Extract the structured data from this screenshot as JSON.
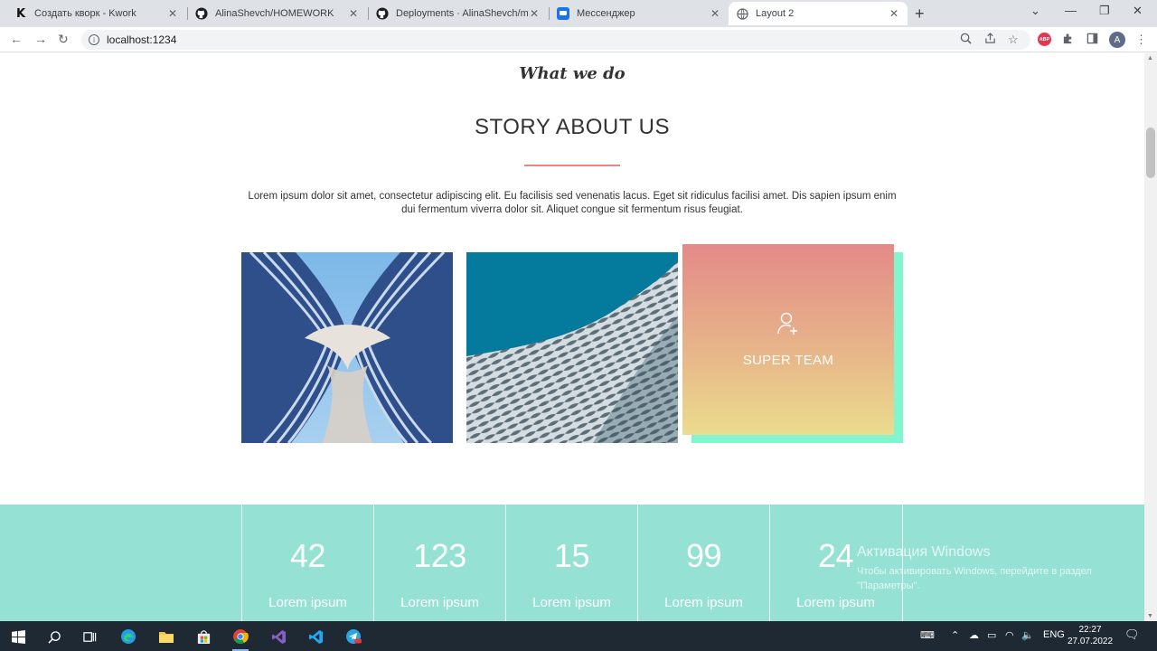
{
  "browser": {
    "tabs": [
      {
        "title": "Создать кворк - Kwork",
        "icon": "kwork-icon",
        "active": false
      },
      {
        "title": "AlinaShevch/HOMEWORK",
        "icon": "github-icon",
        "active": false
      },
      {
        "title": "Deployments · AlinaShevch/mod",
        "icon": "github-icon",
        "active": false
      },
      {
        "title": "Мессенджер",
        "icon": "messenger-icon",
        "active": false
      },
      {
        "title": "Layout 2",
        "icon": "globe-icon",
        "active": true
      }
    ],
    "url": "localhost:1234"
  },
  "page": {
    "subtitle": "What we do",
    "heading": "STORY ABOUT US",
    "lorem": "Lorem ipsum dolor sit amet, consectetur adipiscing elit. Eu facilisis sed venenatis lacus. Eget sit ridiculus facilisi amet. Dis sapien ipsum enim dui fermentum viverra dolor sit. Aliquet congue sit fermentum risus feugiat.",
    "team_label": "SUPER TEAM",
    "accent_color": "#f38181",
    "stats_bg": "#95e1d3",
    "stats": [
      {
        "value": "42",
        "label": "Lorem ipsum"
      },
      {
        "value": "123",
        "label": "Lorem ipsum"
      },
      {
        "value": "15",
        "label": "Lorem ipsum"
      },
      {
        "value": "99",
        "label": "Lorem ipsum"
      },
      {
        "value": "24",
        "label": "Lorem ipsum"
      }
    ]
  },
  "windows": {
    "activation_title": "Активация Windows",
    "activation_text": "Чтобы активировать Windows, перейдите в раздел \"Параметры\".",
    "language": "ENG",
    "time": "22:27",
    "date": "27.07.2022"
  }
}
